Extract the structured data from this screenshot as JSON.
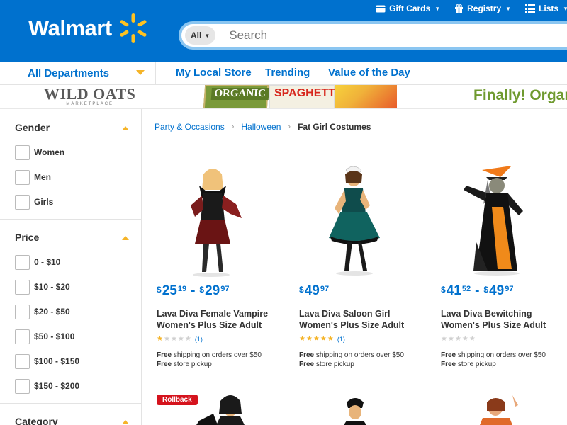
{
  "header": {
    "logo_text": "Walmart",
    "utility": [
      {
        "icon": "gift-card-icon",
        "label": "Gift Cards"
      },
      {
        "icon": "gift-icon",
        "label": "Registry"
      },
      {
        "icon": "list-icon",
        "label": "Lists"
      }
    ],
    "search": {
      "scope": "All",
      "placeholder": "Search"
    }
  },
  "nav": {
    "departments": "All Departments",
    "links": [
      "My Local Store",
      "Trending",
      "Value of the Day"
    ]
  },
  "banner": {
    "brand": "WILD OATS",
    "brand_sub": "MARKETPLACE",
    "pkg1": "ORGANIC",
    "pkg2": "SPAGHETTI",
    "tagline": "Finally! Organ"
  },
  "sidebar": {
    "gender": {
      "title": "Gender",
      "options": [
        "Women",
        "Men",
        "Girls"
      ]
    },
    "price": {
      "title": "Price",
      "options": [
        "0 - $10",
        "$10 - $20",
        "$20 - $50",
        "$50 - $100",
        "$100 - $150",
        "$150 - $200"
      ]
    },
    "category": {
      "title": "Category"
    }
  },
  "breadcrumb": {
    "items": [
      "Party & Occasions",
      "Halloween"
    ],
    "current": "Fat Girl Costumes"
  },
  "products": [
    {
      "price_low_dollars": "25",
      "price_low_cents": "19",
      "price_high_dollars": "29",
      "price_high_cents": "97",
      "title": "Lava Diva Female Vampire Women's Plus Size Adult",
      "rating": 1,
      "review_count": "(1)",
      "ship_label": "Free",
      "ship_text": "shipping on orders over $50",
      "pickup_label": "Free",
      "pickup_text": "store pickup"
    },
    {
      "price_dollars": "49",
      "price_cents": "97",
      "title": "Lava Diva Saloon Girl Women's Plus Size Adult",
      "rating": 5,
      "review_count": "(1)",
      "ship_label": "Free",
      "ship_text": "shipping on orders over $50",
      "pickup_label": "Free",
      "pickup_text": "store pickup"
    },
    {
      "price_low_dollars": "41",
      "price_low_cents": "52",
      "price_high_dollars": "49",
      "price_high_cents": "97",
      "title": "Lava Diva Bewitching Women's Plus Size Adult",
      "rating": 0,
      "review_count": "",
      "ship_label": "Free",
      "ship_text": "shipping on orders over $50",
      "pickup_label": "Free",
      "pickup_text": "store pickup"
    }
  ],
  "rollback_badge": "Rollback",
  "colors": {
    "brand_blue": "#0071ce",
    "spark_yellow": "#ffc220",
    "caret_yellow": "#f5b428",
    "rollback_red": "#d5131d"
  }
}
